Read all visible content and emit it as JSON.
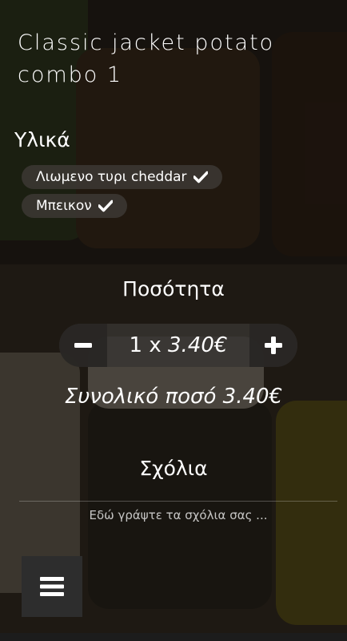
{
  "product": {
    "title": "Classic jacket potato combo 1"
  },
  "ingredients": {
    "heading": "Υλικά",
    "items": [
      {
        "label": "Λιωμενο τυρι cheddar",
        "selected": true
      },
      {
        "label": "Μπεικον",
        "selected": true
      }
    ]
  },
  "quantity": {
    "heading": "Ποσότητα",
    "count_prefix": "1 x",
    "unit_price": "3.40€"
  },
  "total": {
    "label": "Συνολικό ποσό 3.40€"
  },
  "comments": {
    "heading": "Σχόλια",
    "placeholder": "Εδώ γράψτε τα σχόλια σας ..."
  },
  "icons": {
    "check": "check-icon",
    "minus": "minus-icon",
    "plus": "plus-icon",
    "menu": "hamburger-menu-icon"
  }
}
